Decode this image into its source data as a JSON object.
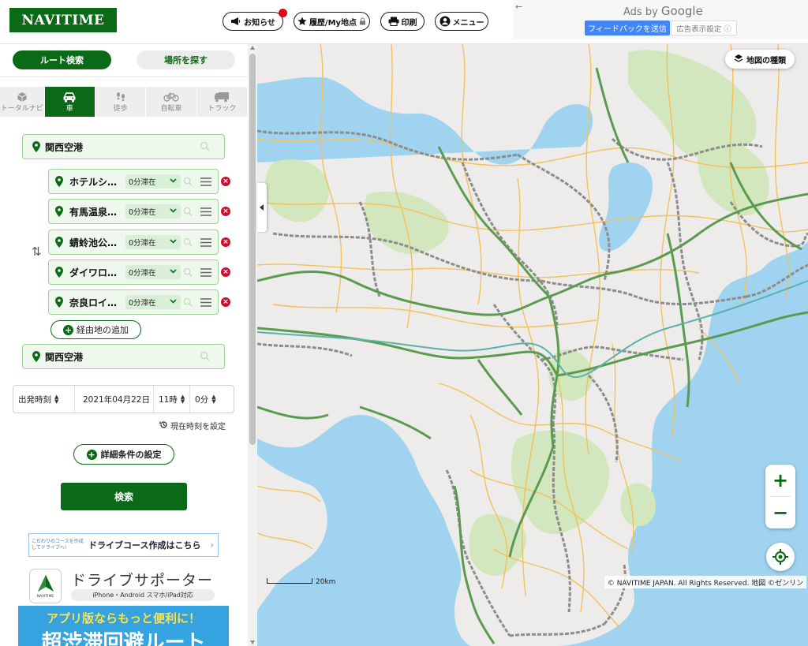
{
  "header": {
    "logo": "NAVITIME",
    "buttons": {
      "news": "お知らせ",
      "history": "履歴/My地点",
      "print": "印刷",
      "menu": "メニュー"
    }
  },
  "ads": {
    "back": "←",
    "ads_by": "Ads by",
    "google": "Google",
    "feedback": "フィードバックを送信",
    "settings": "広告表示設定 ⓘ"
  },
  "tabs": {
    "route_search": "ルート検索",
    "place_search": "場所を探す"
  },
  "modes": [
    {
      "label": "トータルナビ",
      "icon": "cube-icon"
    },
    {
      "label": "車",
      "icon": "car-icon"
    },
    {
      "label": "徒歩",
      "icon": "footprints-icon"
    },
    {
      "label": "自転車",
      "icon": "bicycle-icon"
    },
    {
      "label": "トラック",
      "icon": "truck-icon"
    }
  ],
  "route": {
    "origin": "関西空港",
    "destination": "関西空港",
    "waypoints": [
      {
        "name": "ホテルシ…",
        "stay": "0分滞在"
      },
      {
        "name": "有馬温泉…",
        "stay": "0分滞在"
      },
      {
        "name": "蜻蛉池公…",
        "stay": "0分滞在"
      },
      {
        "name": "ダイワロ…",
        "stay": "0分滞在"
      },
      {
        "name": "奈良ロイ…",
        "stay": "0分滞在"
      }
    ],
    "add_waypoint": "経由地の追加",
    "swap_symbol": "⇅"
  },
  "time": {
    "type": "出発時刻",
    "date": "2021年04月22日",
    "hour": "11時",
    "minute": "0分",
    "now_set": "現在時刻を設定"
  },
  "detail_button": "詳細条件の設定",
  "search_button": "検索",
  "banner": {
    "small_text": "こだわりのコースを作成してドライブへ!",
    "main_text": "ドライブコース作成はこちら",
    "arrow": "›"
  },
  "ad": {
    "icon_text": "NAVITIME",
    "title": "ドライブサポーター",
    "subtitle": "iPhone・Android スマホ/iPad対応",
    "blue_line1": "アプリ版ならもっと便利に！",
    "blue_line2": "超渋滞回避ルート"
  },
  "map": {
    "map_type": "地図の種類",
    "zoom_in": "+",
    "zoom_out": "−",
    "scale": "20km",
    "copyright": "© NAVITIME JAPAN. All Rights Reserved. 地図 ©ゼンリン"
  },
  "colors": {
    "brand_green": "#0b6a18",
    "sea": "#9fd3ef",
    "land": "#eeeceb",
    "forest": "#d2e7bd",
    "highway": "#5b9b4f",
    "rail": "#8c8c8c",
    "road": "#f1c15a",
    "delete_red": "#c8102e"
  }
}
